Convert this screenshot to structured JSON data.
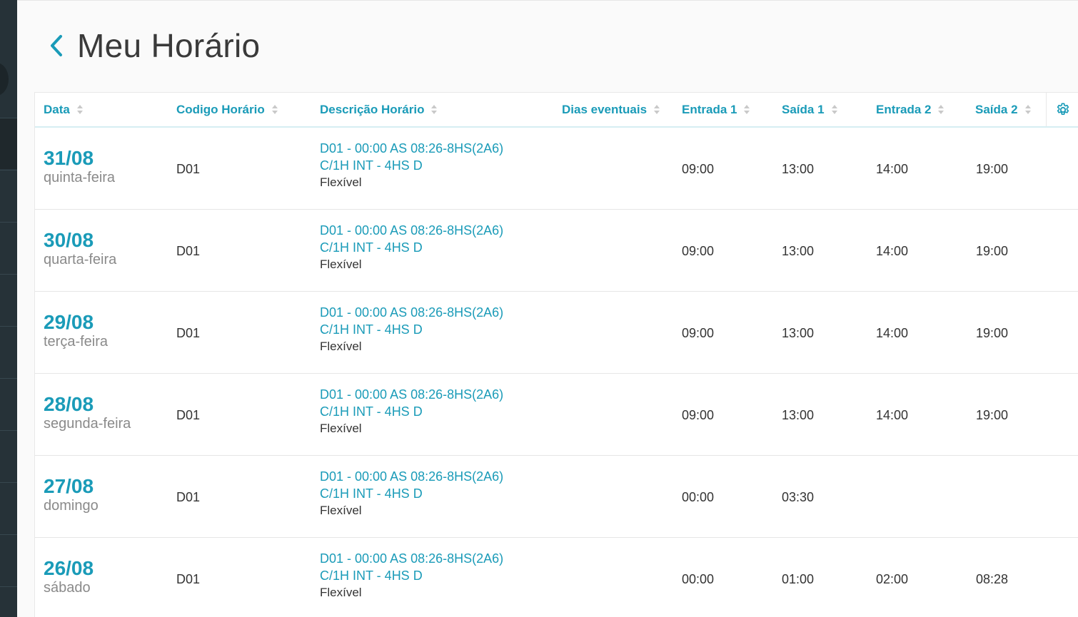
{
  "header": {
    "title": "Meu Horário"
  },
  "table": {
    "columns": [
      {
        "key": "data",
        "label": "Data"
      },
      {
        "key": "codigo",
        "label": "Codigo Horário"
      },
      {
        "key": "descricao",
        "label": "Descrição Horário"
      },
      {
        "key": "dias",
        "label": "Dias eventuais"
      },
      {
        "key": "entrada1",
        "label": "Entrada 1"
      },
      {
        "key": "saida1",
        "label": "Saída 1"
      },
      {
        "key": "entrada2",
        "label": "Entrada 2"
      },
      {
        "key": "saida2",
        "label": "Saída 2"
      }
    ],
    "rows": [
      {
        "date": "31/08",
        "weekday": "quinta-feira",
        "code": "D01",
        "desc1": "D01 - 00:00 AS 08:26-8HS(2A6)",
        "desc2": "C/1H INT - 4HS D",
        "desc3": "Flexível",
        "dias": "",
        "entrada1": "09:00",
        "saida1": "13:00",
        "entrada2": "14:00",
        "saida2": "19:00"
      },
      {
        "date": "30/08",
        "weekday": "quarta-feira",
        "code": "D01",
        "desc1": "D01 - 00:00 AS 08:26-8HS(2A6)",
        "desc2": "C/1H INT - 4HS D",
        "desc3": "Flexível",
        "dias": "",
        "entrada1": "09:00",
        "saida1": "13:00",
        "entrada2": "14:00",
        "saida2": "19:00"
      },
      {
        "date": "29/08",
        "weekday": "terça-feira",
        "code": "D01",
        "desc1": "D01 - 00:00 AS 08:26-8HS(2A6)",
        "desc2": "C/1H INT - 4HS D",
        "desc3": "Flexível",
        "dias": "",
        "entrada1": "09:00",
        "saida1": "13:00",
        "entrada2": "14:00",
        "saida2": "19:00"
      },
      {
        "date": "28/08",
        "weekday": "segunda-feira",
        "code": "D01",
        "desc1": "D01 - 00:00 AS 08:26-8HS(2A6)",
        "desc2": "C/1H INT - 4HS D",
        "desc3": "Flexível",
        "dias": "",
        "entrada1": "09:00",
        "saida1": "13:00",
        "entrada2": "14:00",
        "saida2": "19:00"
      },
      {
        "date": "27/08",
        "weekday": "domingo",
        "code": "D01",
        "desc1": "D01 - 00:00 AS 08:26-8HS(2A6)",
        "desc2": "C/1H INT - 4HS D",
        "desc3": "Flexível",
        "dias": "",
        "entrada1": "00:00",
        "saida1": "03:30",
        "entrada2": "",
        "saida2": ""
      },
      {
        "date": "26/08",
        "weekday": "sábado",
        "code": "D01",
        "desc1": "D01 - 00:00 AS 08:26-8HS(2A6)",
        "desc2": "C/1H INT - 4HS D",
        "desc3": "Flexível",
        "dias": "",
        "entrada1": "00:00",
        "saida1": "01:00",
        "entrada2": "02:00",
        "saida2": "08:28"
      }
    ]
  },
  "icons": {
    "back": "chevron-left-icon",
    "sort": "sort-icon",
    "settings": "gear-icon"
  },
  "colors": {
    "accent": "#1a9bb8",
    "sidebar": "#263238",
    "text": "#333333",
    "muted": "#8a8a8a"
  }
}
